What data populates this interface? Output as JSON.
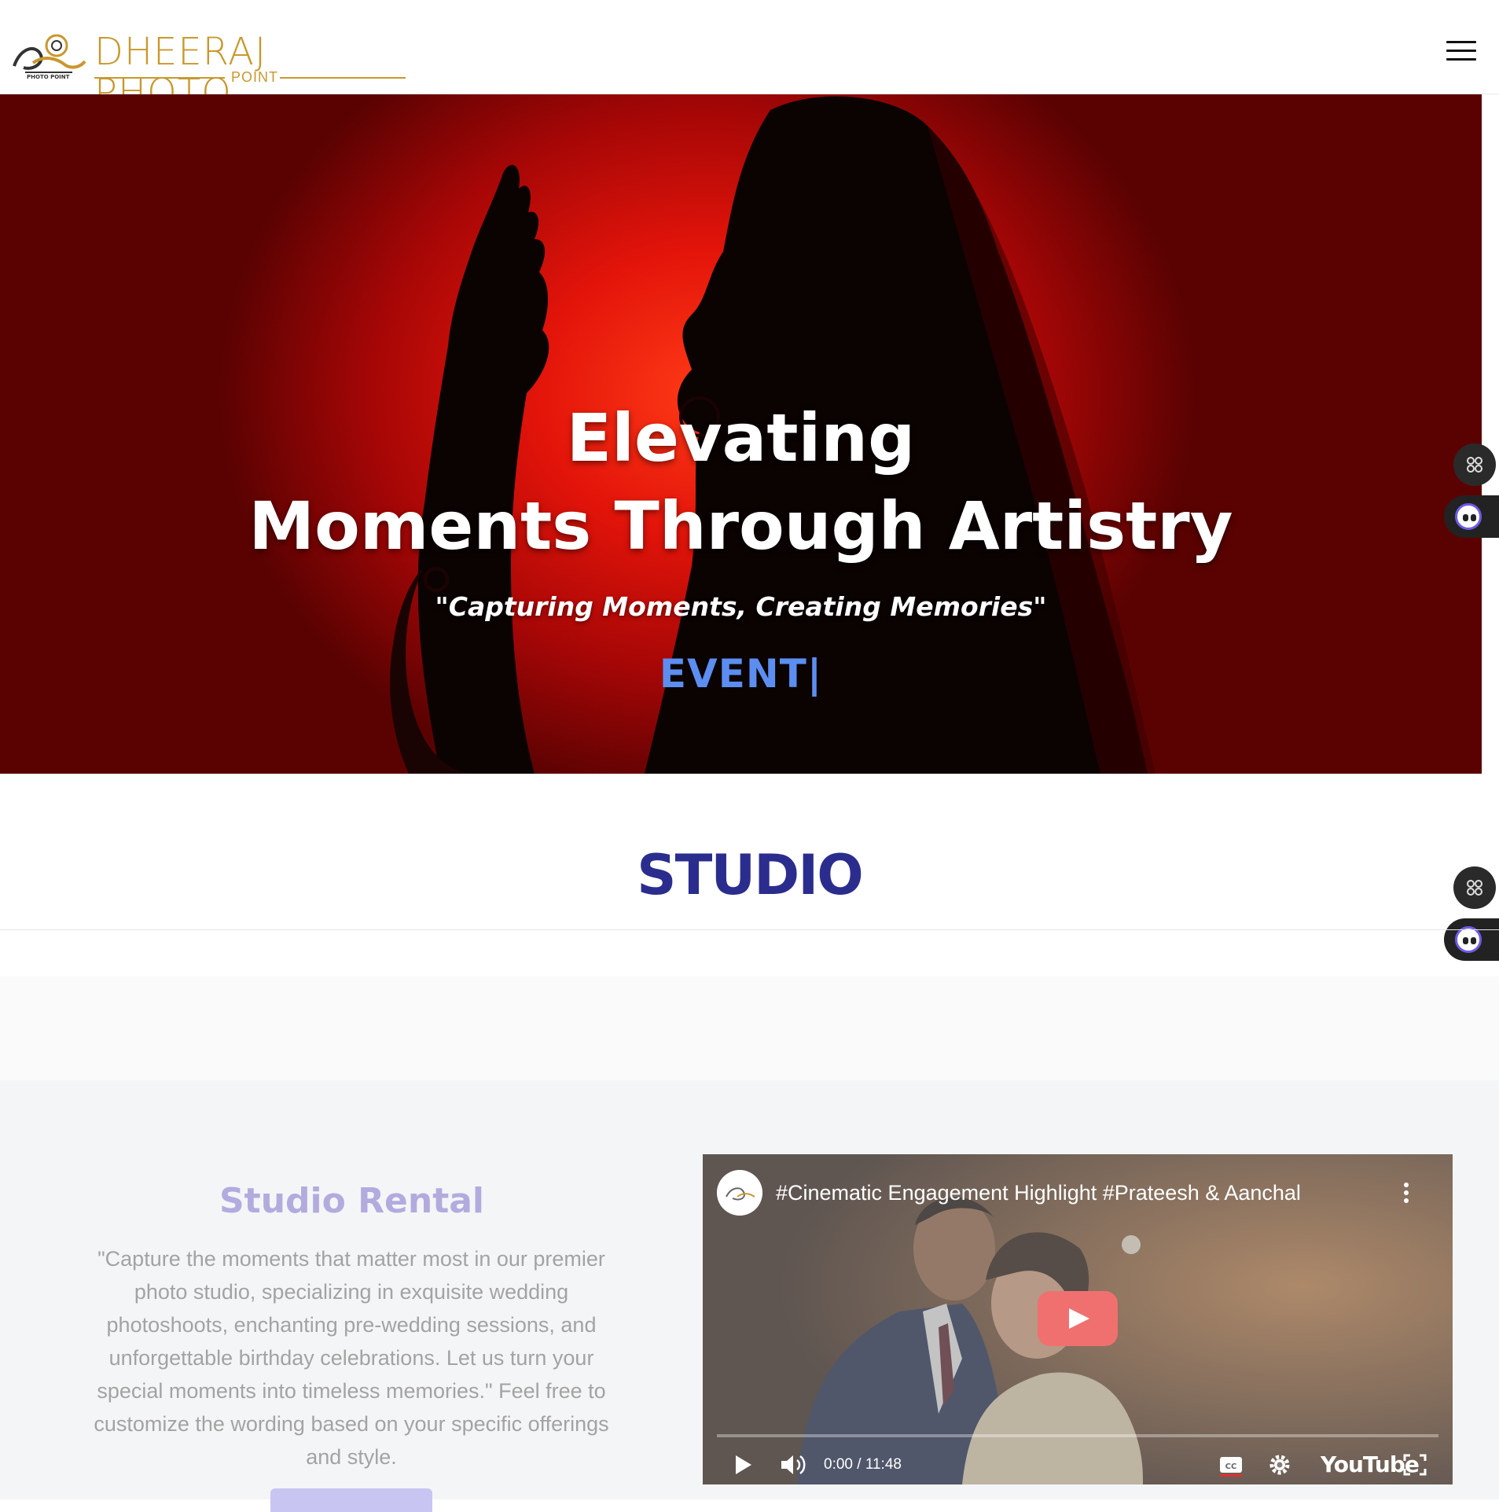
{
  "header": {
    "logo_mark_text": "Dheeraj",
    "logo_text": "DHEERAJ PHOTO",
    "logo_subtext": "POINT",
    "menu_icon": "hamburger-icon"
  },
  "hero": {
    "title_line1": "Elevating",
    "title_line2": "Moments Through Artistry",
    "tagline": "\"Capturing Moments, Creating Memories\"",
    "typed_text": "EVENT|",
    "typed_color": "#5b8ef0"
  },
  "floating_widgets": {
    "apps_icon": "command-grid-icon",
    "assistant_icon": "robot-face-icon"
  },
  "studio": {
    "section_title": "STUDIO",
    "rental_title": "Studio Rental",
    "rental_description": "\"Capture the moments that matter most in our premier photo studio, specializing in exquisite wedding photoshoots, enchanting pre-wedding sessions, and unforgettable birthday celebrations. Let us turn your special moments into timeless memories.\" Feel free to customize the wording based on your specific offerings and style."
  },
  "video": {
    "title": "#Cinematic Engagement Highlight #Prateesh & Aanchal",
    "time": "0:00 / 11:48",
    "platform": "YouTube",
    "progress": 0
  },
  "colors": {
    "brand_gold": "#c9982c",
    "section_title": "#2b2d8e",
    "rental_title": "#b3abde",
    "hero_red": "#e3140a"
  }
}
